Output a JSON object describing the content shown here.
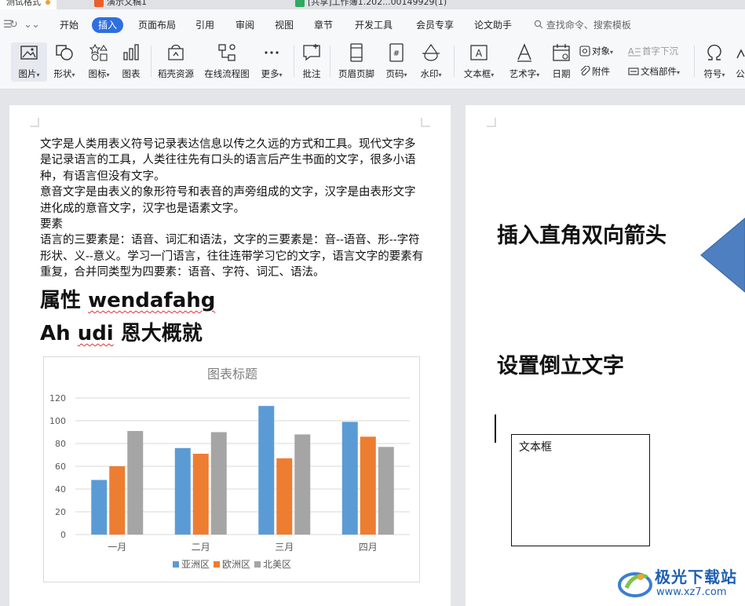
{
  "tabs": [
    {
      "label": "测试格式",
      "active": true
    },
    {
      "label": "演示文稿1",
      "active": false
    },
    {
      "label": "[共享]工作簿1.202...00149929(1)",
      "active": false
    }
  ],
  "menu": {
    "items": [
      "开始",
      "插入",
      "页面布局",
      "引用",
      "审阅",
      "视图",
      "章节",
      "开发工具",
      "会员专享",
      "论文助手"
    ],
    "active": "插入",
    "search_placeholder": "查找命令、搜索模板"
  },
  "ribbon": {
    "picture": "图片",
    "shape": "形状",
    "icon": "图标",
    "chart": "图表",
    "resources": "稻壳资源",
    "flowchart": "在线流程图",
    "more": "更多",
    "comment": "批注",
    "header_footer": "页眉页脚",
    "page_number": "页码",
    "watermark": "水印",
    "text_box": "文本框",
    "word_art": "艺术字",
    "date": "日期",
    "object": "对象",
    "attachment": "附件",
    "drop_cap": "首字下沉",
    "doc_parts": "文档部件",
    "symbol": "符号",
    "formula": "公"
  },
  "page1": {
    "paragraphs": [
      "文字是人类用表义符号记录表达信息以传之久远的方式和工具。现代文字多是记录语言的工具，人类往往先有口头的语言后产生书面的文字，很多小语种，有语言但没有文字。",
      "意音文字是由表义的象形符号和表音的声旁组成的文字，汉字是由表形文字进化成的意音文字，汉字也是语素文字。",
      "要素",
      "语言的三要素是：语音、词汇和语法，文字的三要素是：音--语音、形--字符形状、义--意义。学习一门语言，往往连带学习它的文字，语言文字的要素有重复，合并同类型为四要素：语音、字符、词汇、语法。"
    ],
    "heading1_prefix": "属性 ",
    "heading1_word": "wendafahg",
    "heading2_prefix": "Ah ",
    "heading2_word": "udi",
    "heading2_suffix": " 恩大概就"
  },
  "chart_data": {
    "type": "bar",
    "title": "图表标题",
    "categories": [
      "一月",
      "二月",
      "三月",
      "四月"
    ],
    "series": [
      {
        "name": "亚洲区",
        "color": "#5b9bd5",
        "values": [
          48,
          76,
          113,
          99
        ]
      },
      {
        "name": "欧洲区",
        "color": "#ed7d31",
        "values": [
          60,
          71,
          67,
          86
        ]
      },
      {
        "name": "北美区",
        "color": "#a5a5a5",
        "values": [
          91,
          90,
          88,
          77
        ]
      }
    ],
    "ylim": [
      0,
      120
    ],
    "yticks": [
      0,
      20,
      40,
      60,
      80,
      100,
      120
    ],
    "grid": true,
    "legend": "bottom",
    "xlabel": "",
    "ylabel": ""
  },
  "page2": {
    "heading1": "插入直角双向箭头",
    "heading2": "设置倒立文字",
    "textbox_label": "文本框",
    "arrow_color": "#4e7fc1"
  },
  "watermark": {
    "title": "极光下载站",
    "url": "www.xz7.com"
  }
}
